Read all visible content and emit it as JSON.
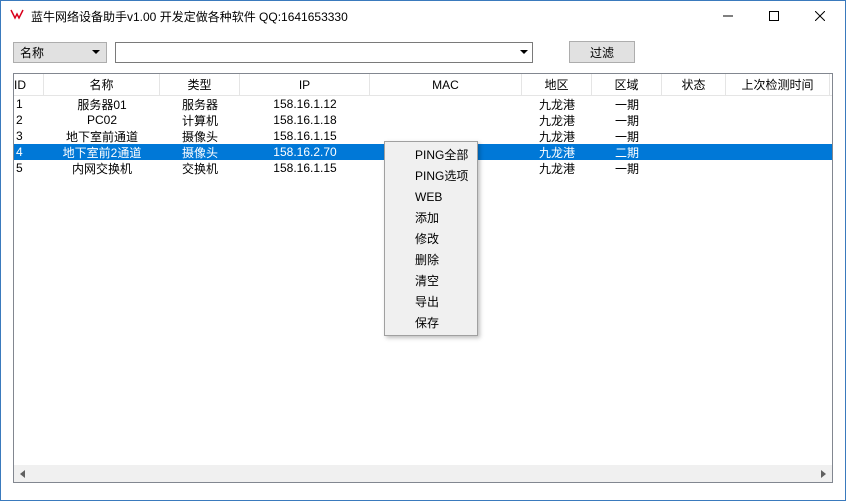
{
  "window": {
    "title": "蓝牛网络设备助手v1.00   开发定做各种软件 QQ:1641653330"
  },
  "toolbar": {
    "combo_label": "名称",
    "filter_label": "过滤"
  },
  "columns": {
    "id": "ID",
    "name": "名称",
    "type": "类型",
    "ip": "IP",
    "mac": "MAC",
    "area": "地区",
    "zone": "区域",
    "status": "状态",
    "last": "上次检测时间"
  },
  "rows": [
    {
      "id": "1",
      "name": "服务器01",
      "type": "服务器",
      "ip": "158.16.1.12",
      "mac": "",
      "area": "九龙港",
      "zone": "一期",
      "status": "",
      "last": ""
    },
    {
      "id": "2",
      "name": "PC02",
      "type": "计算机",
      "ip": "158.16.1.18",
      "mac": "",
      "area": "九龙港",
      "zone": "一期",
      "status": "",
      "last": ""
    },
    {
      "id": "3",
      "name": "地下室前通道",
      "type": "摄像头",
      "ip": "158.16.1.15",
      "mac": "",
      "area": "九龙港",
      "zone": "一期",
      "status": "",
      "last": ""
    },
    {
      "id": "4",
      "name": "地下室前2通道",
      "type": "摄像头",
      "ip": "158.16.2.70",
      "mac": "",
      "area": "九龙港",
      "zone": "二期",
      "status": "",
      "last": "",
      "selected": true
    },
    {
      "id": "5",
      "name": "内网交换机",
      "type": "交换机",
      "ip": "158.16.1.15",
      "mac": "",
      "area": "九龙港",
      "zone": "一期",
      "status": "",
      "last": ""
    }
  ],
  "context_menu": {
    "items": [
      "PING全部",
      "PING选项",
      "WEB",
      "添加",
      "修改",
      "删除",
      "清空",
      "导出",
      "保存"
    ]
  }
}
